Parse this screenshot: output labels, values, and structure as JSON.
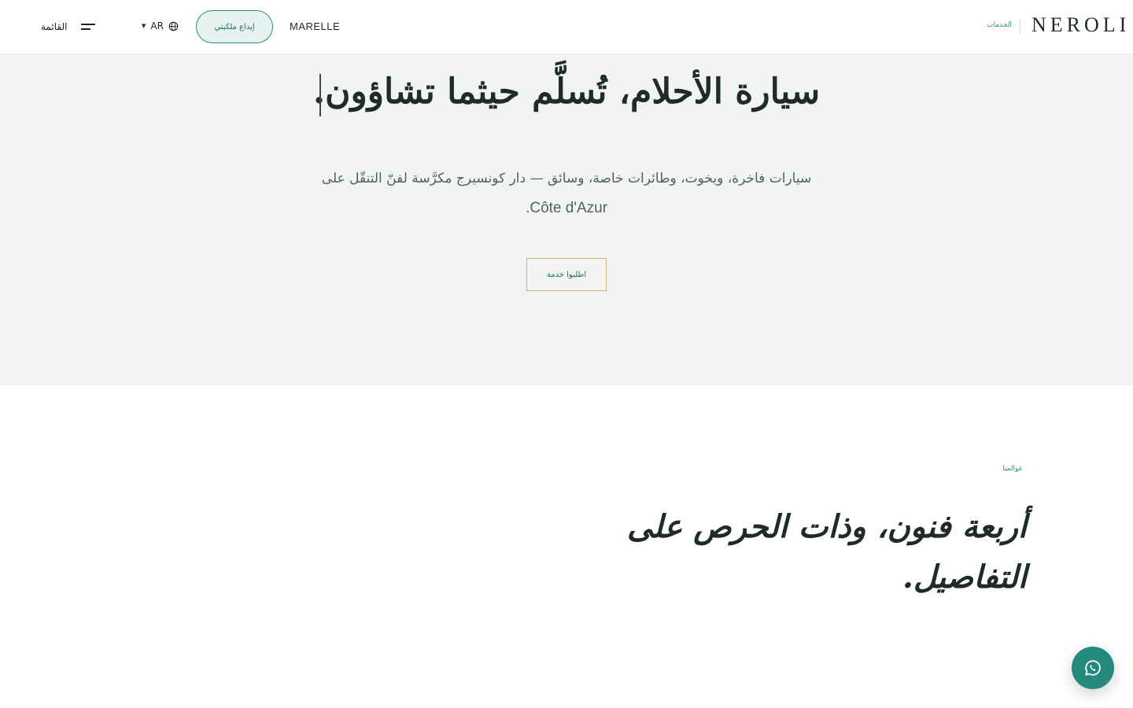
{
  "header": {
    "menu_label": "القائمة",
    "language": "AR",
    "deposit_label": "إيداع ملكيتي",
    "marelle_label": "MARELLE",
    "services_label": "الخدمات",
    "logo_text": "NEROLI"
  },
  "hero": {
    "title": "سيارة الأحلام، تُسلَّم حيثما تشاؤون.",
    "subtitle_ar": "سيارات فاخرة، ويخوت، وطائرات خاصة، وسائق — دار كونسيرج مكرَّسة لفنّ التنقّل على",
    "subtitle_latin": "Côte d'Azur",
    "subtitle_end": ".",
    "cta_label": "اطلبوا خدمة"
  },
  "worlds": {
    "eyebrow": "عوالمنا",
    "title": "أربعة فنون، وذات الحرص على التفاصيل."
  },
  "icons": {
    "menu": "hamburger-icon",
    "language": "globe-icon",
    "whatsapp": "whatsapp-icon"
  },
  "colors": {
    "accent": "#2e8b80",
    "cta_border": "#d4b36a",
    "hero_background": "#f2f4f4",
    "whatsapp": "#238a7c"
  }
}
